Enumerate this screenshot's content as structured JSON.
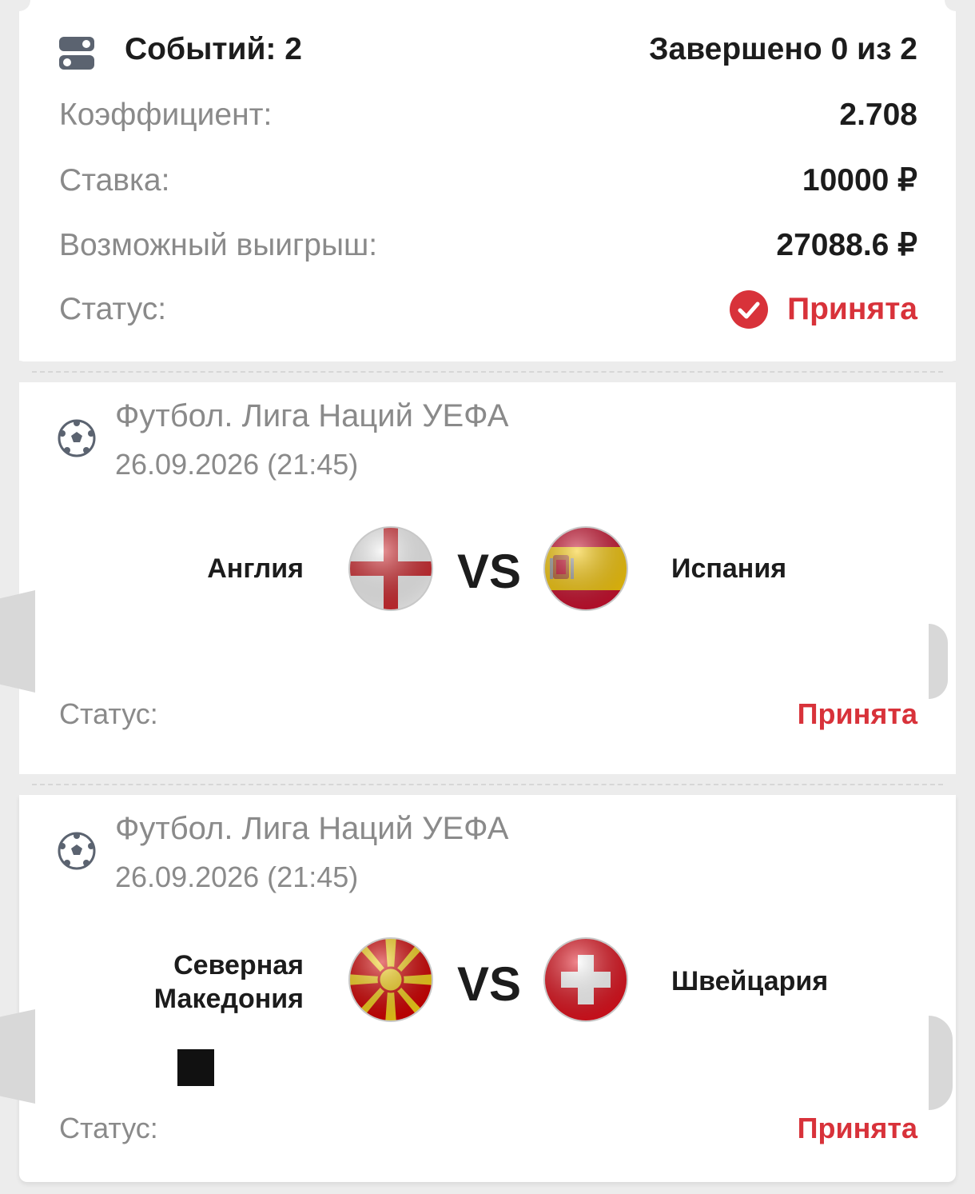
{
  "summary": {
    "events_label": "Событий: 2",
    "completed_label": "Завершено 0 из 2",
    "coef_label": "Коэффициент:",
    "coef_value": "2.708",
    "stake_label": "Ставка:",
    "stake_value": "10000 ₽",
    "win_label": "Возможный выигрыш:",
    "win_value": "27088.6 ₽",
    "status_label": "Статус:",
    "status_value": "Принята"
  },
  "events": [
    {
      "title": "Футбол. Лига Наций УЕФА",
      "date": "26.09.2026 (21:45)",
      "home": "Англия",
      "away": "Испания",
      "vs": "VS",
      "status_label": "Статус:",
      "status_value": "Принята"
    },
    {
      "title": "Футбол. Лига Наций УЕФА",
      "date": "26.09.2026 (21:45)",
      "home": "Северная Македония",
      "away": "Швейцария",
      "vs": "VS",
      "status_label": "Статус:",
      "status_value": "Принята"
    }
  ],
  "colors": {
    "accent_red": "#d8323a",
    "label_gray": "#8a8a8a",
    "text_dark": "#1c1c1c"
  },
  "icons": {
    "summary": "toggle-icon",
    "status": "check-circle-icon",
    "sport": "soccer-ball-icon",
    "flags": [
      "england-flag-icon",
      "spain-flag-icon",
      "north-macedonia-flag-icon",
      "switzerland-flag-icon"
    ]
  }
}
